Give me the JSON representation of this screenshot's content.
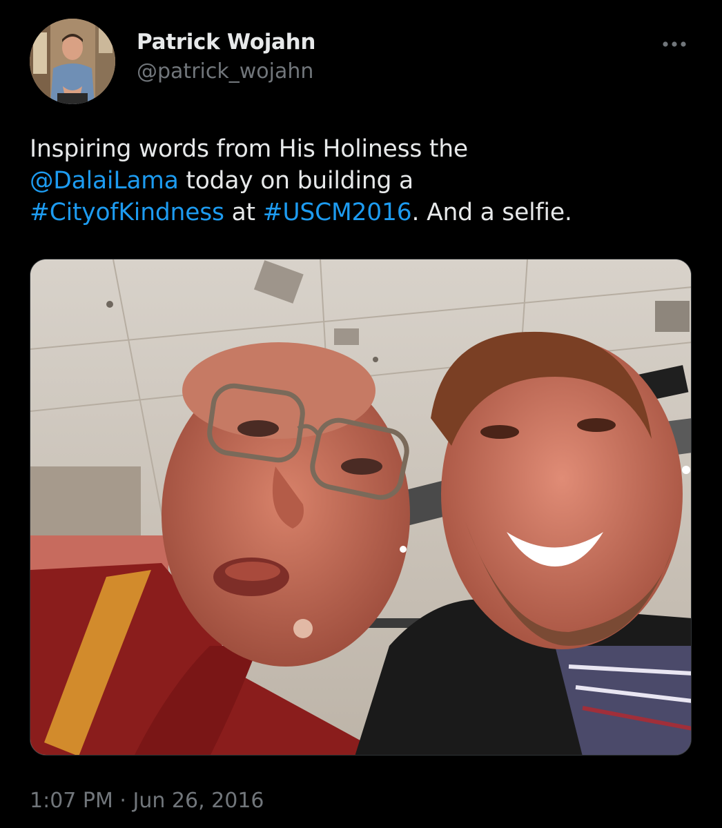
{
  "author": {
    "display_name": "Patrick Wojahn",
    "handle": "@patrick_wojahn",
    "avatar_icon": "profile-photo"
  },
  "tweet": {
    "segments": [
      {
        "text": "Inspiring words from His Holiness the ",
        "type": "plain"
      },
      {
        "text": "@DalaiLama",
        "type": "mention"
      },
      {
        "text": " today on building a ",
        "type": "plain"
      },
      {
        "text": "#CityofKindness",
        "type": "hashtag"
      },
      {
        "text": " at ",
        "type": "plain"
      },
      {
        "text": "#USCM2016",
        "type": "hashtag"
      },
      {
        "text": ". And a selfie.",
        "type": "plain"
      }
    ],
    "time": "1:07 PM",
    "separator": " · ",
    "date": "Jun 26, 2016"
  },
  "more_icon": "more-horizontal-icon",
  "colors": {
    "background": "#000000",
    "primary_text": "#e7e9ea",
    "secondary_text": "#71767b",
    "link": "#1d9bf0"
  }
}
